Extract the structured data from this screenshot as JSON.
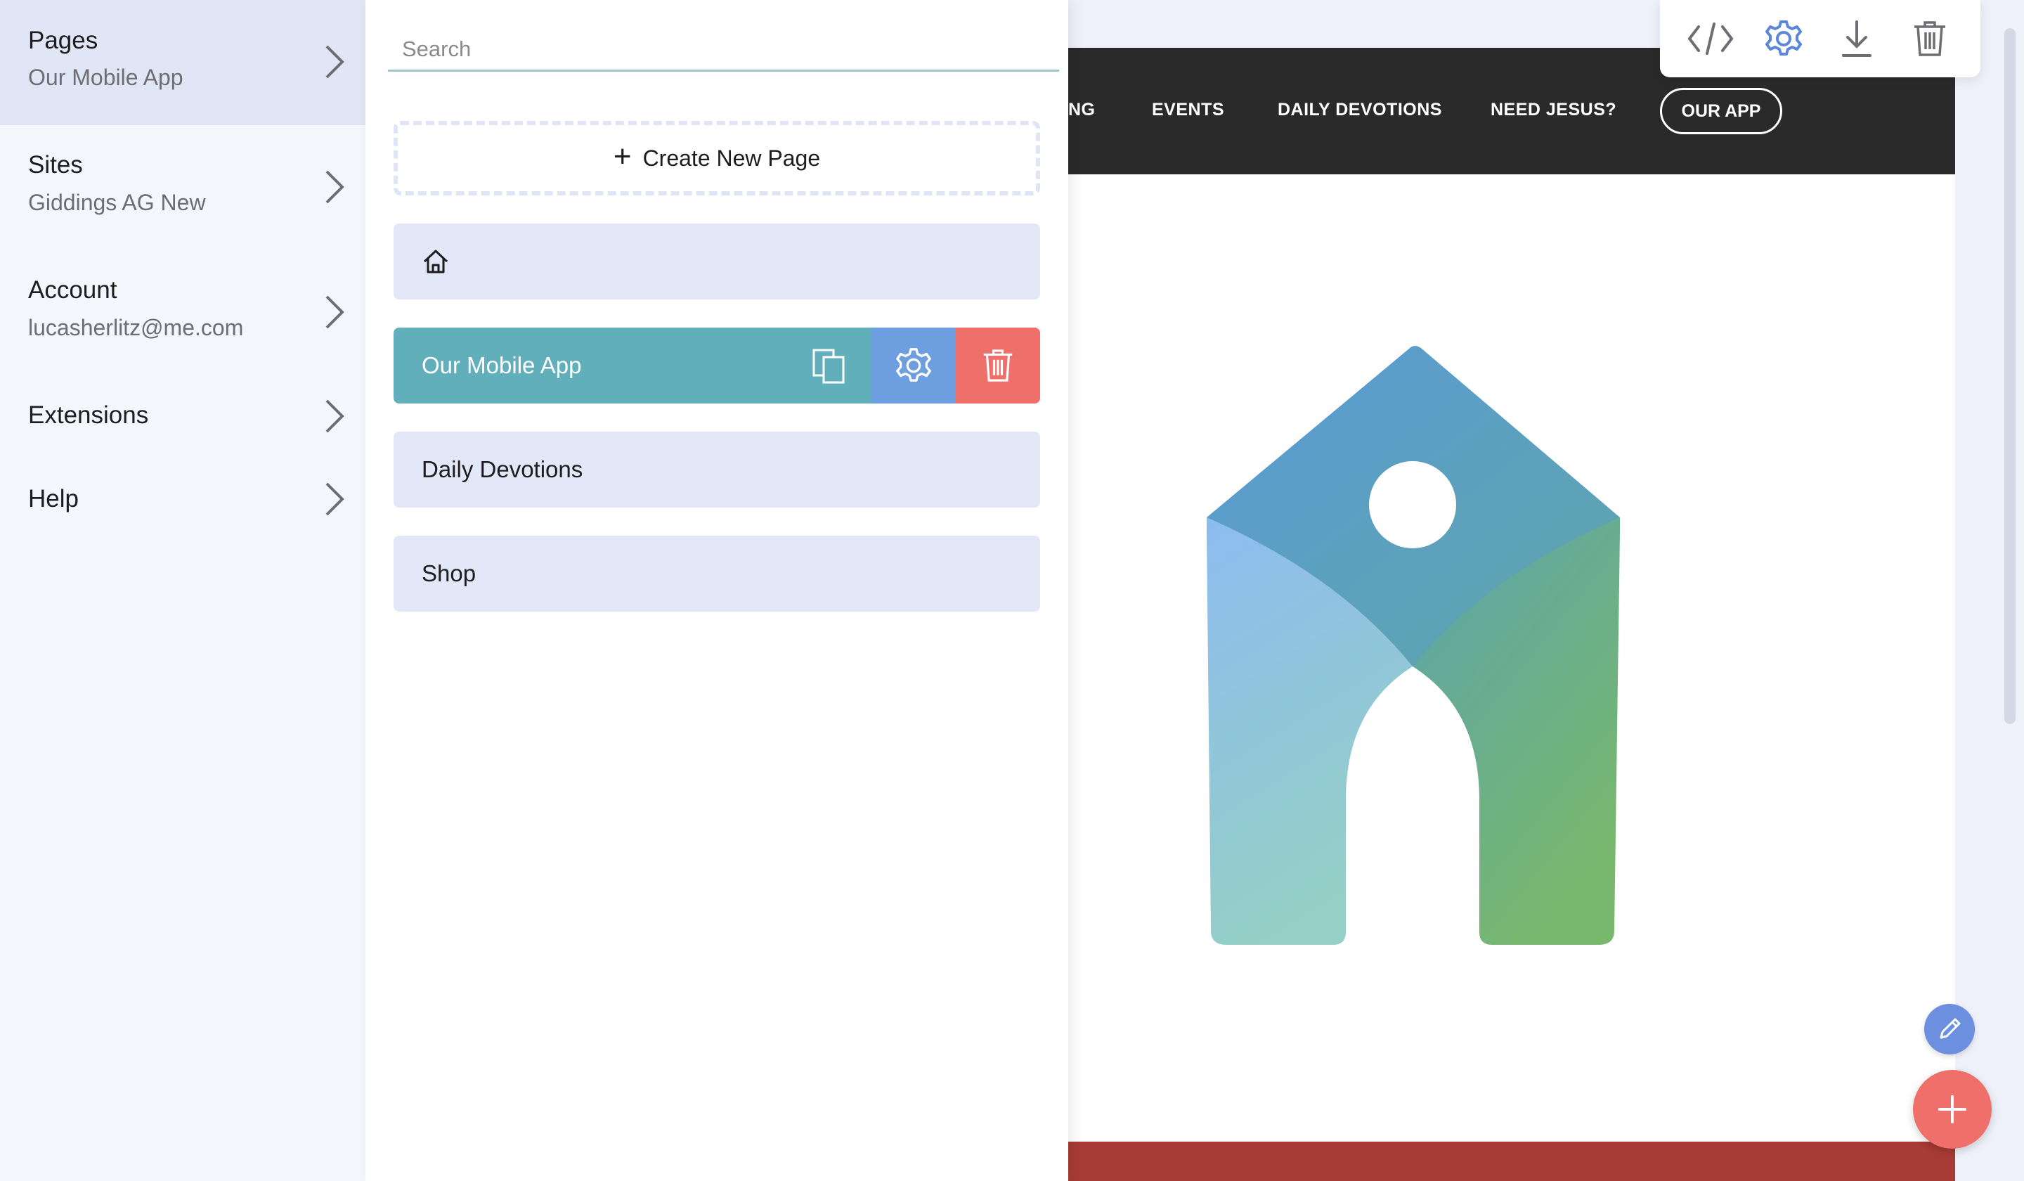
{
  "sidebar": {
    "items": [
      {
        "title": "Pages",
        "subtitle": "Our Mobile App"
      },
      {
        "title": "Sites",
        "subtitle": "Giddings AG New"
      },
      {
        "title": "Account",
        "subtitle": "lucasherlitz@me.com"
      },
      {
        "title": "Extensions"
      },
      {
        "title": "Help"
      }
    ]
  },
  "pages_panel": {
    "search_placeholder": "Search",
    "create_label": "Create New Page",
    "pages": [
      {
        "label": "",
        "icon": "home-icon"
      },
      {
        "label": "Our Mobile App",
        "selected": true
      },
      {
        "label": "Daily Devotions"
      },
      {
        "label": "Shop"
      }
    ]
  },
  "preview": {
    "nav_links": [
      "NG",
      "EVENTS",
      "DAILY DEVOTIONS",
      "NEED JESUS?"
    ],
    "nav_button": "OUR APP"
  },
  "toolbar": {
    "icons": [
      "code-icon",
      "gear-icon",
      "download-icon",
      "trash-icon"
    ]
  },
  "colors": {
    "selected_row": "#62afbc",
    "settings_action": "#6d9fe0",
    "delete_action": "#ef6f6a",
    "nav_bg": "#2a2a2a",
    "footer_bg": "#a83b35"
  }
}
